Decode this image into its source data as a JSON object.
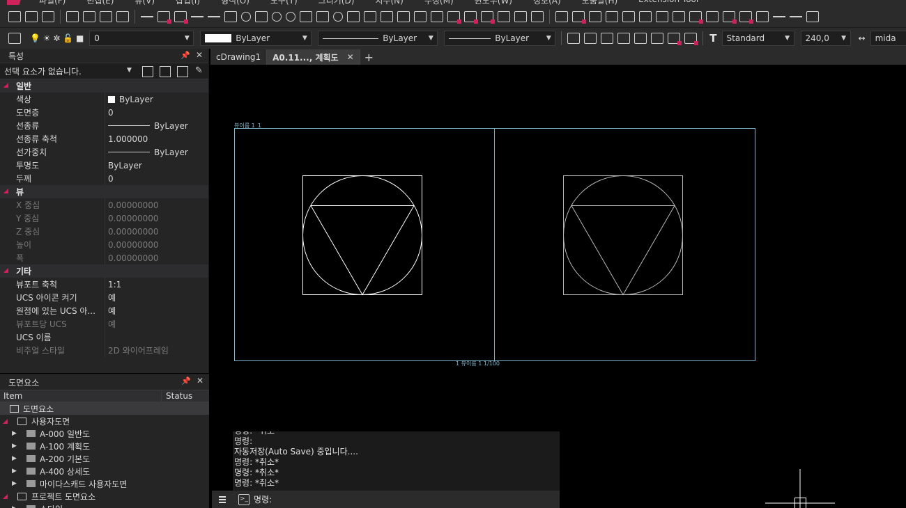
{
  "menu": [
    "파일(F)",
    "편집(E)",
    "뷰(V)",
    "삽입(I)",
    "형식(O)",
    "도구(T)",
    "그리기(D)",
    "치수(N)",
    "수정(M)",
    "윈도우(W)",
    "정보(A)",
    "도움말(H)",
    "Extension Tool"
  ],
  "toolbar2": {
    "layer_value": "0",
    "color_value": "ByLayer",
    "linetype_value": "ByLayer",
    "lineweight_value": "ByLayer",
    "text_style_value": "Standard",
    "text_height_value": "240,0",
    "dim_style_value": "mida"
  },
  "properties": {
    "title": "특성",
    "selection": "선택 요소가 없습니다.",
    "categories": [
      {
        "label": "일반",
        "rows": [
          {
            "name": "색상",
            "value": "ByLayer",
            "kind": "swatch"
          },
          {
            "name": "도면층",
            "value": "0"
          },
          {
            "name": "선종류",
            "value": "ByLayer",
            "kind": "line"
          },
          {
            "name": "선종류 축척",
            "value": "1.000000"
          },
          {
            "name": "선가중치",
            "value": "ByLayer",
            "kind": "line"
          },
          {
            "name": "투명도",
            "value": "ByLayer"
          },
          {
            "name": "두께",
            "value": "0"
          }
        ]
      },
      {
        "label": "뷰",
        "rows": [
          {
            "name": "X 중심",
            "value": "0.00000000",
            "dim": true
          },
          {
            "name": "Y 중심",
            "value": "0.00000000",
            "dim": true
          },
          {
            "name": "Z 중심",
            "value": "0.00000000",
            "dim": true
          },
          {
            "name": "높이",
            "value": "0.00000000",
            "dim": true
          },
          {
            "name": "폭",
            "value": "0.00000000",
            "dim": true
          }
        ]
      },
      {
        "label": "기타",
        "rows": [
          {
            "name": "뷰포트 축척",
            "value": "1:1"
          },
          {
            "name": "UCS 아이콘 켜기",
            "value": "예"
          },
          {
            "name": "원점에 있는 UCS 아...",
            "value": "예"
          },
          {
            "name": "뷰포트당 UCS",
            "value": "예",
            "dim": true
          },
          {
            "name": "UCS 이름",
            "value": ""
          },
          {
            "name": "비주얼 스타일",
            "value": "2D 와이어프레임",
            "dim": true
          }
        ]
      }
    ]
  },
  "sheet": {
    "title": "도면요소",
    "col_item": "Item",
    "col_status": "Status",
    "rows": [
      {
        "label": "도면요소",
        "level": 0,
        "type": "root"
      },
      {
        "label": "사용자도면",
        "level": 1,
        "type": "group",
        "expanded": true
      },
      {
        "label": "A-000 일반도",
        "level": 2,
        "type": "folder"
      },
      {
        "label": "A-100 계획도",
        "level": 2,
        "type": "folder"
      },
      {
        "label": "A-200 기본도",
        "level": 2,
        "type": "folder"
      },
      {
        "label": "A-400 상세도",
        "level": 2,
        "type": "folder"
      },
      {
        "label": "마이다스캐드 사용자도면",
        "level": 2,
        "type": "folder"
      },
      {
        "label": "프로젝트 도면요소",
        "level": 1,
        "type": "group",
        "expanded": true
      },
      {
        "label": "스타일",
        "level": 2,
        "type": "folder"
      }
    ]
  },
  "tabs": [
    {
      "label": "cDrawing1",
      "active": false
    },
    {
      "label": "A0.11..., 계획도",
      "active": true
    }
  ],
  "canvas": {
    "viewport_label_top": "뷰이름 1_1",
    "viewport_label_bottom": "1 뷰이름 1 1/100"
  },
  "command": {
    "history": [
      "명령: *취소*",
      "명령:",
      "자동저장(Auto Save) 중입니다....",
      "명령: *취소*",
      "명령: *취소*",
      "명령: *취소*"
    ],
    "prompt": "명령:"
  },
  "colors": {
    "accent": "#d0225a",
    "viewport_frame": "#7fb8d0",
    "panel_bg": "#252526",
    "toolbar_bg": "#2b2b2b"
  }
}
